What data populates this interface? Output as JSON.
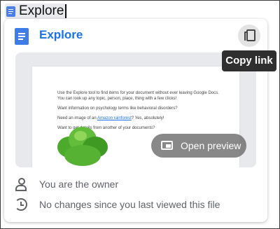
{
  "doc_chip": {
    "label": "Explore"
  },
  "card": {
    "title": "Explore",
    "copy_link_tooltip": "Copy link",
    "open_preview_label": "Open preview"
  },
  "preview_doc": {
    "line1": "Use the Explore tool to find items for your document without ever leaving Google Docs.",
    "line2": "You can look up any topic, person, place, thing with a few clicks!",
    "line3": "Want information on psychology terms like behavioral disorders?",
    "line4_before": "Need an image of an ",
    "line4_link": "Amazon rainforest",
    "line4_after": "? Yes, absolutely!",
    "line5": "Want to get details from another of your documents?"
  },
  "details": {
    "owner": "You are the owner",
    "changes": "No changes since you last viewed this file"
  },
  "colors": {
    "accent": "#1a73e8",
    "doc_icon": "#4a7fe8",
    "tooltip_bg": "#2f2f2f"
  },
  "icons": {
    "doc": "docs-icon",
    "copy": "copy-link-icon",
    "preview": "open-preview-icon",
    "owner": "person-icon",
    "changes": "history-icon"
  }
}
